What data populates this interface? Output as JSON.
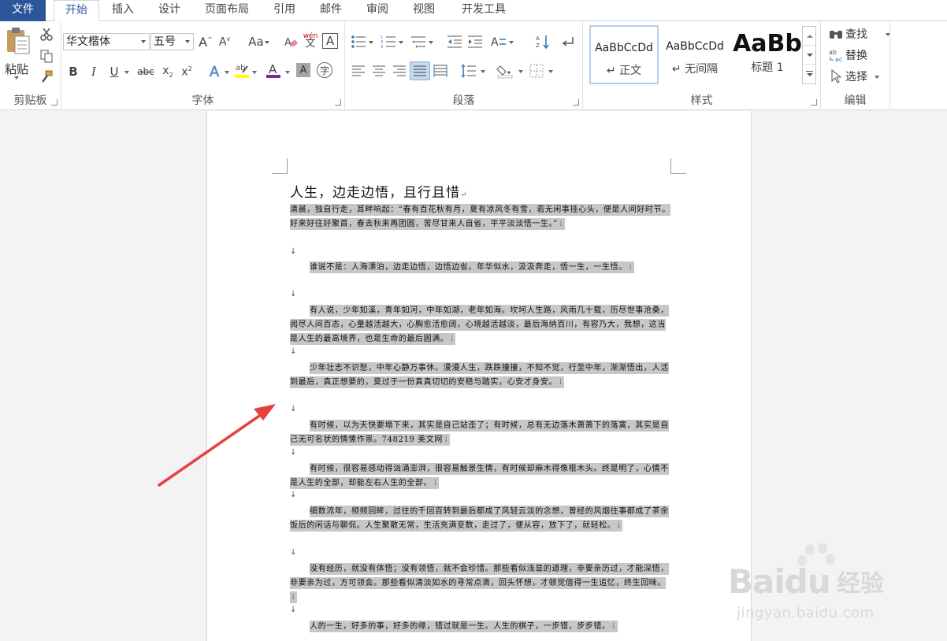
{
  "tabs": [
    "文件",
    "开始",
    "插入",
    "设计",
    "页面布局",
    "引用",
    "邮件",
    "审阅",
    "视图",
    "开发工具"
  ],
  "ribbon": {
    "clipboard": {
      "paste_label": "粘贴",
      "group_label": "剪贴板"
    },
    "font": {
      "font_name": "华文楷体",
      "font_size": "五号",
      "group_label": "字体",
      "case_label": "Aa",
      "wen_label": "wén",
      "A_label": "A",
      "clear_char": "A"
    },
    "paragraph": {
      "group_label": "段落"
    },
    "styles": {
      "group_label": "样式",
      "items": [
        {
          "sample": "AaBbCcDd",
          "name": "↵ 正文"
        },
        {
          "sample": "AaBbCcDd",
          "name": "↵ 无间隔"
        },
        {
          "sample": "AaBb",
          "name": "标题 1"
        }
      ]
    },
    "editing": {
      "find": "查找",
      "replace": "替换",
      "select": "选择",
      "group_label": "编辑"
    }
  },
  "document": {
    "title": "人生，边走边悟，且行且惜",
    "paragraphs": [
      "清晨，独自行走，耳畔响起：“春有百花秋有月，夏有凉风冬有雪，若无闲事挂心头，便是人间好时节。好来好往好聚首，春去秋来再团圆，苦尽甘来人自省，平平淡淡悟一生。”",
      "谁说不是：人海漂泊，边走边悟，边悟边省。年华似水，汲汲奔走，悟一生，一生悟。",
      "有人说，少年如溪，青年如河，中年如湖，老年如海。坎坷人生路，风雨几十载，历尽世事沧桑，阅尽人间百态，心量越活越大，心胸愈活愈阔，心境越活越淡，最后海纳百川，有容乃大，我想，这当是人生的最高境界，也是生命的最后圆满。",
      "少年壮志不识愁，中年心静万事休。漫漫人生，跌跌撞撞，不知不觉，行至中年，渐渐悟出，人活到最后，真正想要的，莫过于一份真真切切的安稳与踏实，心安才身安。",
      "有时候，以为天快要塌下来，其实是自己站歪了；有时候，总有无边落木萧萧下的落寞，其实是自己无可名状的情愫作祟。748219 美文网",
      "有时候，很容易感动得汹涌澎湃，很容易触景生情，有时候却麻木得像根木头。终是明了，心情不是人生的全部，却能左右人生的全部。",
      "细数流年，频频回眸，过往的千回百转到最后都成了风轻云淡的念想，曾经的风烟往事都成了茶余饭后的闲话与聊侃。人生聚散无常，生活充满变数，走过了，便从容，放下了，就轻松。",
      "没有经历，就没有体悟；没有领悟，就不会珍惜。那些看似浅显的道理，非要亲历过，才能深悟，非要亲为过，方可领会。那些看似清淡如水的寻常点滴，回头怀想，才顿觉值得一生追忆，终生回味。",
      "人的一生，好多的事，好多的缘，错过就是一生。人生的棋子，一步错，步步错。"
    ],
    "return_mark": "↵",
    "line_mark": "↓"
  },
  "watermark": {
    "brand": "Bai",
    "brand2": "du",
    "cn": "经验",
    "url": "jingyan.baidu.com"
  },
  "colors": {
    "file_tab": "#2b579a",
    "highlight": "#c7c7c7",
    "arrow": "#e8403e",
    "font_color_bar": "#7030a0",
    "highlight_bar": "#ffff00"
  }
}
